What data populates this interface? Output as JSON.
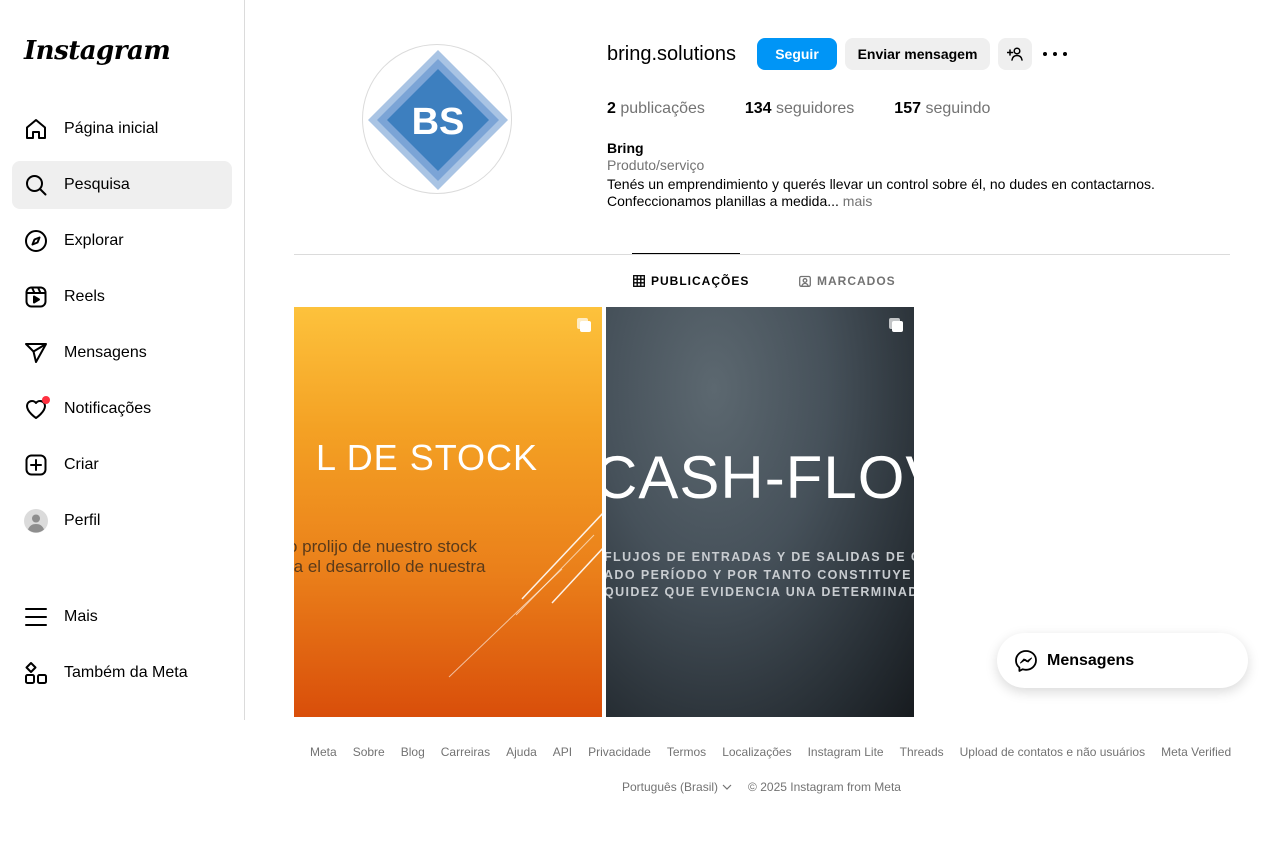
{
  "app": {
    "logo": "Instagram"
  },
  "sidebar": {
    "items": [
      {
        "label": "Página inicial",
        "icon": "home-icon"
      },
      {
        "label": "Pesquisa",
        "icon": "search-icon",
        "active": true
      },
      {
        "label": "Explorar",
        "icon": "compass-icon"
      },
      {
        "label": "Reels",
        "icon": "reels-icon"
      },
      {
        "label": "Mensagens",
        "icon": "send-icon"
      },
      {
        "label": "Notificações",
        "icon": "heart-icon"
      },
      {
        "label": "Criar",
        "icon": "plus-square-icon"
      },
      {
        "label": "Perfil",
        "icon": "avatar-icon"
      },
      {
        "label": "Mais",
        "icon": "menu-icon"
      },
      {
        "label": "Também da Meta",
        "icon": "meta-apps-icon"
      }
    ]
  },
  "profile": {
    "avatar_text": "BS",
    "username": "bring.solutions",
    "follow_label": "Seguir",
    "message_label": "Enviar mensagem",
    "stats": {
      "posts_count": "2",
      "posts_label": "publicações",
      "followers_count": "134",
      "followers_label": "seguidores",
      "following_count": "157",
      "following_label": "seguindo"
    },
    "name": "Bring",
    "category": "Produto/serviço",
    "bio_line1": "Tenés un emprendimiento y querés llevar un control sobre él, no dudes en contactarnos.",
    "bio_line2": "Confeccionamos planillas a medida...",
    "bio_more": "mais"
  },
  "tabs": [
    {
      "label": "PUBLICAÇÕES",
      "icon": "grid-icon",
      "active": true
    },
    {
      "label": "MARCADOS",
      "icon": "tagged-icon"
    }
  ],
  "posts": [
    {
      "title": "L DE STOCK",
      "sub1": "o prolijo de nuestro stock",
      "sub2": "ra el desarrollo de nuestra",
      "multi": true
    },
    {
      "title": "CASH-FLOV",
      "sub1": "FLUJOS DE ENTRADAS Y DE SALIDAS DE CAJA O E",
      "sub2": "ADO PERÍODO Y POR TANTO CONSTITUYE UN IND",
      "sub3": "QUIDEZ QUE EVIDENCIA UNA DETERMINADA EMP",
      "multi": true
    }
  ],
  "footer": {
    "links": [
      "Meta",
      "Sobre",
      "Blog",
      "Carreiras",
      "Ajuda",
      "API",
      "Privacidade",
      "Termos",
      "Localizações",
      "Instagram Lite",
      "Threads",
      "Upload de contatos e não usuários",
      "Meta Verified"
    ],
    "language": "Português (Brasil)",
    "copyright": "© 2025 Instagram from Meta"
  },
  "messages_float": {
    "label": "Mensagens"
  },
  "colors": {
    "primary_blue": "#0095f6",
    "notification_red": "#ff3040",
    "avatar_blue": "#3d7fbf"
  }
}
